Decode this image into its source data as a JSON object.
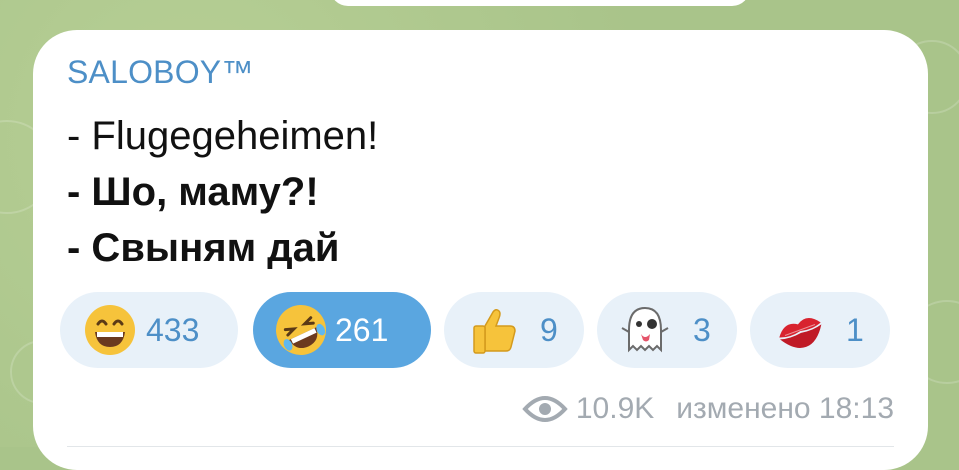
{
  "message": {
    "sender": "SALOBOY™",
    "lines": [
      "- Flugegeheimen!",
      "- Шо, маму?!",
      "- Свыням дай"
    ]
  },
  "reactions": [
    {
      "emoji": "grinning-face",
      "count": "433",
      "active": false
    },
    {
      "emoji": "rolling-on-floor-laughing",
      "count": "261",
      "active": true
    },
    {
      "emoji": "thumbs-up",
      "count": "9",
      "active": false
    },
    {
      "emoji": "ghost",
      "count": "3",
      "active": false
    },
    {
      "emoji": "kiss-mark",
      "count": "1",
      "active": false
    }
  ],
  "footer": {
    "views": "10.9K",
    "status": "изменено 18:13"
  },
  "colors": {
    "sender": "#4d8fc7",
    "reaction_bg": "#e8f1f9",
    "reaction_active_bg": "#5aa6e0",
    "meta": "#a3aab1"
  }
}
